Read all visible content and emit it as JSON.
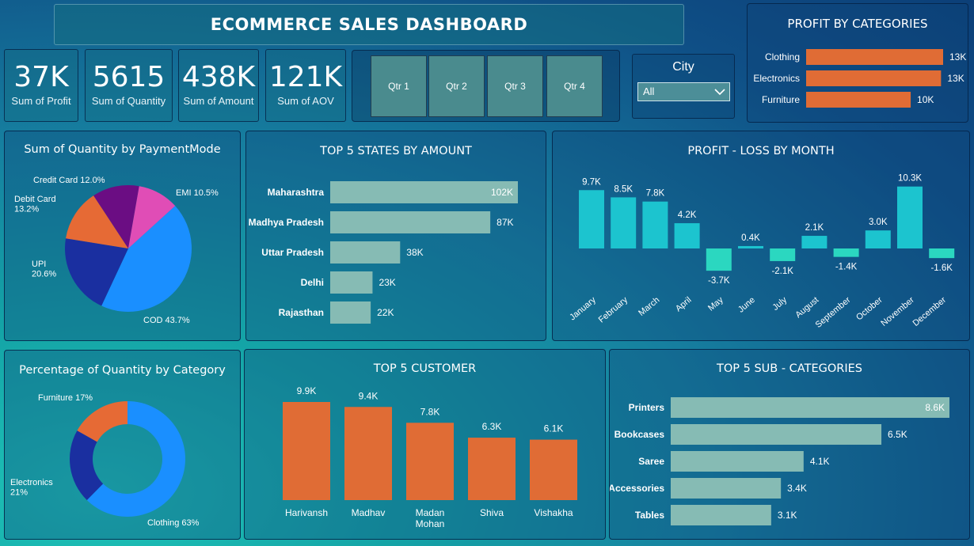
{
  "dashboard_title": "ECOMMERCE SALES DASHBOARD",
  "kpis": [
    {
      "value": "37K",
      "label": "Sum of Profit"
    },
    {
      "value": "5615",
      "label": "Sum of Quantity"
    },
    {
      "value": "438K",
      "label": "Sum of Amount"
    },
    {
      "value": "121K",
      "label": "Sum of AOV"
    }
  ],
  "quarters": [
    "Qtr 1",
    "Qtr 2",
    "Qtr 3",
    "Qtr 4"
  ],
  "city_filter": {
    "label": "City",
    "selected": "All"
  },
  "colors": {
    "orange": "#e06c35",
    "teal": "#1cc4cf",
    "teal_neg": "#2bd7c0",
    "pale": "#86bbb4"
  },
  "chart_data": [
    {
      "id": "profit_by_categories",
      "type": "bar",
      "orientation": "horizontal",
      "title": "PROFIT BY CATEGORIES",
      "categories": [
        "Clothing",
        "Electronics",
        "Furniture"
      ],
      "values": [
        13.1,
        12.9,
        10.0
      ],
      "data_labels": [
        "13K",
        "13K",
        "10K"
      ],
      "color": "#e06c35"
    },
    {
      "id": "quantity_by_paymentmode",
      "type": "pie",
      "title": "Sum of Quantity by PaymentMode",
      "categories": [
        "COD",
        "UPI",
        "Debit Card",
        "Credit Card",
        "EMI"
      ],
      "values": [
        43.7,
        20.6,
        13.2,
        12.0,
        10.5
      ],
      "data_labels": [
        "COD 43.7%",
        "UPI\n20.6%",
        "Debit Card\n13.2%",
        "Credit Card 12.0%",
        "EMI 10.5%"
      ],
      "colors": [
        "#1a8fff",
        "#1a2fa0",
        "#e66a35",
        "#6b0d83",
        "#e04db6"
      ]
    },
    {
      "id": "top5_states_by_amount",
      "type": "bar",
      "orientation": "horizontal",
      "title": "TOP 5 STATES BY AMOUNT",
      "categories": [
        "Maharashtra",
        "Madhya Pradesh",
        "Uttar Pradesh",
        "Delhi",
        "Rajasthan"
      ],
      "values": [
        102,
        87,
        38,
        23,
        22
      ],
      "data_labels": [
        "102K",
        "87K",
        "38K",
        "23K",
        "22K"
      ],
      "color": "#86bbb4"
    },
    {
      "id": "profit_loss_by_month",
      "type": "bar",
      "title": "PROFIT - LOSS BY MONTH",
      "categories": [
        "January",
        "February",
        "March",
        "April",
        "May",
        "June",
        "July",
        "August",
        "September",
        "October",
        "November",
        "December"
      ],
      "values": [
        9.7,
        8.5,
        7.8,
        4.2,
        -3.7,
        0.4,
        -2.1,
        2.1,
        -1.4,
        3.0,
        10.3,
        -1.6
      ],
      "data_labels": [
        "9.7K",
        "8.5K",
        "7.8K",
        "4.2K",
        "-3.7K",
        "0.4K",
        "-2.1K",
        "2.1K",
        "-1.4K",
        "3.0K",
        "10.3K",
        "-1.6K"
      ],
      "colors": {
        "positive": "#1cc4cf",
        "negative": "#2bd7c0"
      }
    },
    {
      "id": "quantity_pct_by_category",
      "type": "pie",
      "variant": "donut",
      "title": "Percentage of Quantity by Category",
      "categories": [
        "Clothing",
        "Electronics",
        "Furniture"
      ],
      "values": [
        63,
        21,
        17
      ],
      "data_labels": [
        "Clothing 63%",
        "Electronics\n21%",
        "Furniture 17%"
      ],
      "colors": [
        "#1a8fff",
        "#1a2fa0",
        "#e66a35"
      ]
    },
    {
      "id": "top5_customer",
      "type": "bar",
      "title": "TOP 5 CUSTOMER",
      "categories": [
        "Harivansh",
        "Madhav",
        "Madan\nMohan",
        "Shiva",
        "Vishakha"
      ],
      "values": [
        9.9,
        9.4,
        7.8,
        6.3,
        6.1
      ],
      "data_labels": [
        "9.9K",
        "9.4K",
        "7.8K",
        "6.3K",
        "6.1K"
      ],
      "color": "#e06c35"
    },
    {
      "id": "top5_sub_categories",
      "type": "bar",
      "orientation": "horizontal",
      "title": "TOP 5 SUB - CATEGORIES",
      "categories": [
        "Printers",
        "Bookcases",
        "Saree",
        "Accessories",
        "Tables"
      ],
      "values": [
        8.6,
        6.5,
        4.1,
        3.4,
        3.1
      ],
      "data_labels": [
        "8.6K",
        "6.5K",
        "4.1K",
        "3.4K",
        "3.1K"
      ],
      "color": "#86bbb4"
    }
  ]
}
